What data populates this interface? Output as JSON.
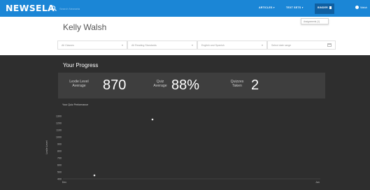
{
  "nav": {
    "logo": "NEWSELA",
    "search_placeholder": "Search Newsela",
    "links": [
      "ARTICLES ▾",
      "TEXT SETS ▾",
      "BINDER"
    ],
    "user_label": "Walsh",
    "menu_popup": "Assignments (1)"
  },
  "student": {
    "name": "Kelly Walsh"
  },
  "filters": [
    {
      "label": "All Classes"
    },
    {
      "label": "All Reading Standards"
    },
    {
      "label": "English and Spanish"
    },
    {
      "label": "Select date range"
    }
  ],
  "progress": {
    "title": "Your Progress",
    "stats": [
      {
        "label_line1": "Lexile Level",
        "label_line2": "Average",
        "value": "870"
      },
      {
        "label_line1": "Quiz",
        "label_line2": "Average",
        "value": "88%"
      },
      {
        "label_line1": "Quizzes",
        "label_line2": "Taken",
        "value": "2"
      }
    ]
  },
  "colors": {
    "accent": "#1b86d6",
    "panel": "#2e2e2e",
    "stats_bg": "#3e3e3e"
  },
  "chart_data": {
    "type": "scatter",
    "title": "Your Quiz Performance",
    "ylabel": "Lexile Level",
    "ylim": [
      400,
      1300
    ],
    "y_ticks": [
      "1300",
      "1200",
      "1100",
      "1000",
      "900",
      "800",
      "700",
      "600",
      "500",
      "400"
    ],
    "x_ticks": [
      "Dec",
      "Jan"
    ],
    "points": [
      {
        "x": "Dec",
        "y": 450
      },
      {
        "x": "Jan",
        "y": 1250
      }
    ]
  }
}
